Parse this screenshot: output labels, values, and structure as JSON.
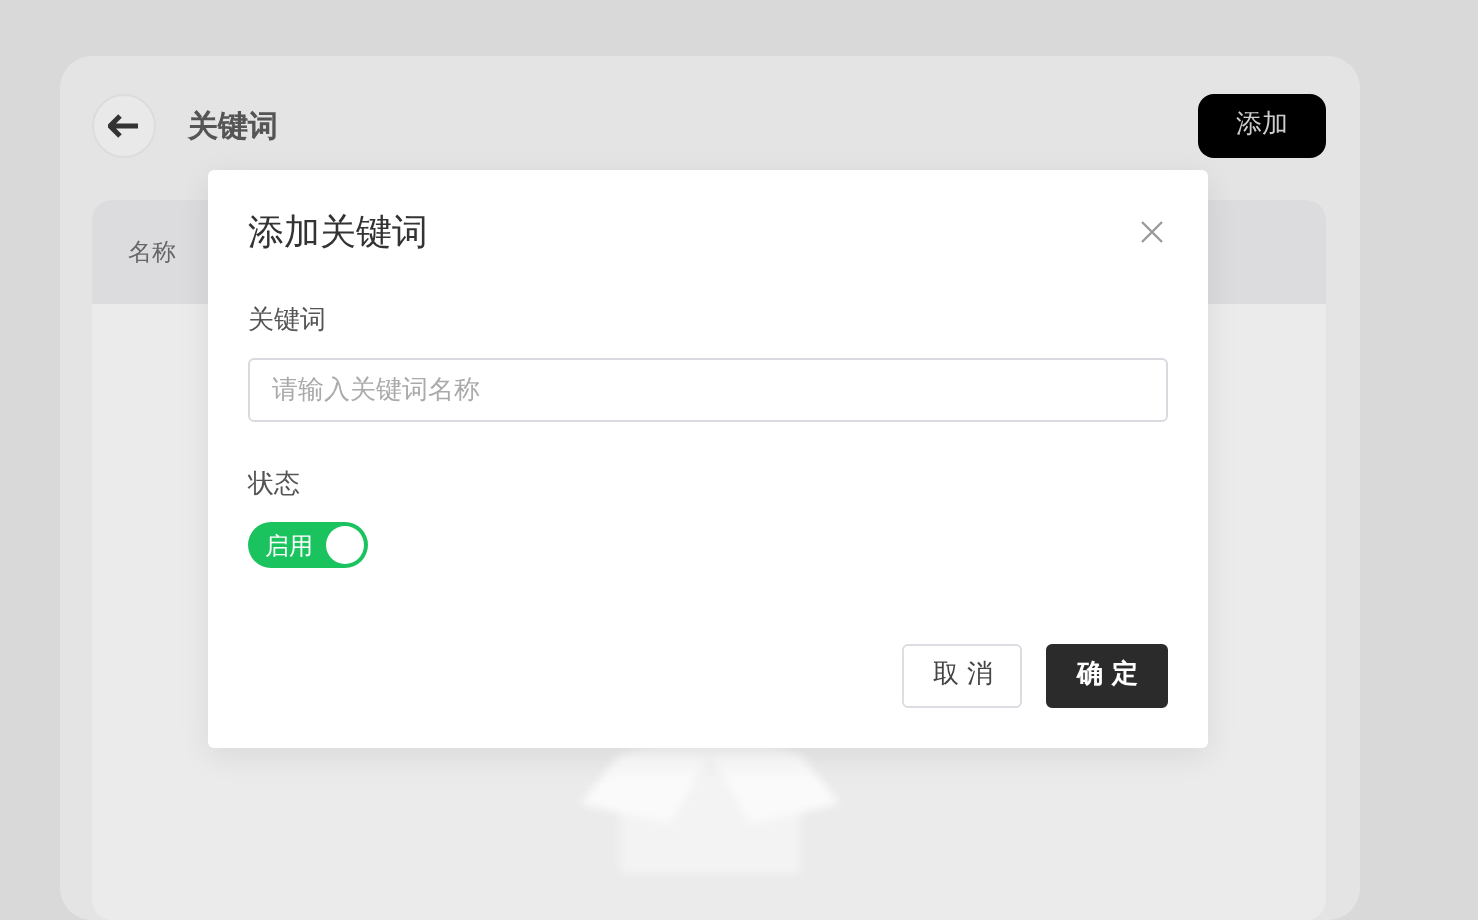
{
  "page": {
    "title": "关键词",
    "add_button": "添加",
    "table": {
      "columns": [
        "名称"
      ]
    }
  },
  "dialog": {
    "title": "添加关键词",
    "field": {
      "label": "关键词",
      "placeholder": "请输入关键词名称"
    },
    "status": {
      "label": "状态",
      "on": true,
      "text": "启用"
    },
    "buttons": [
      {
        "label": "取 消",
        "kind": "secondary"
      },
      {
        "label": "确 定",
        "kind": "primary"
      }
    ]
  }
}
